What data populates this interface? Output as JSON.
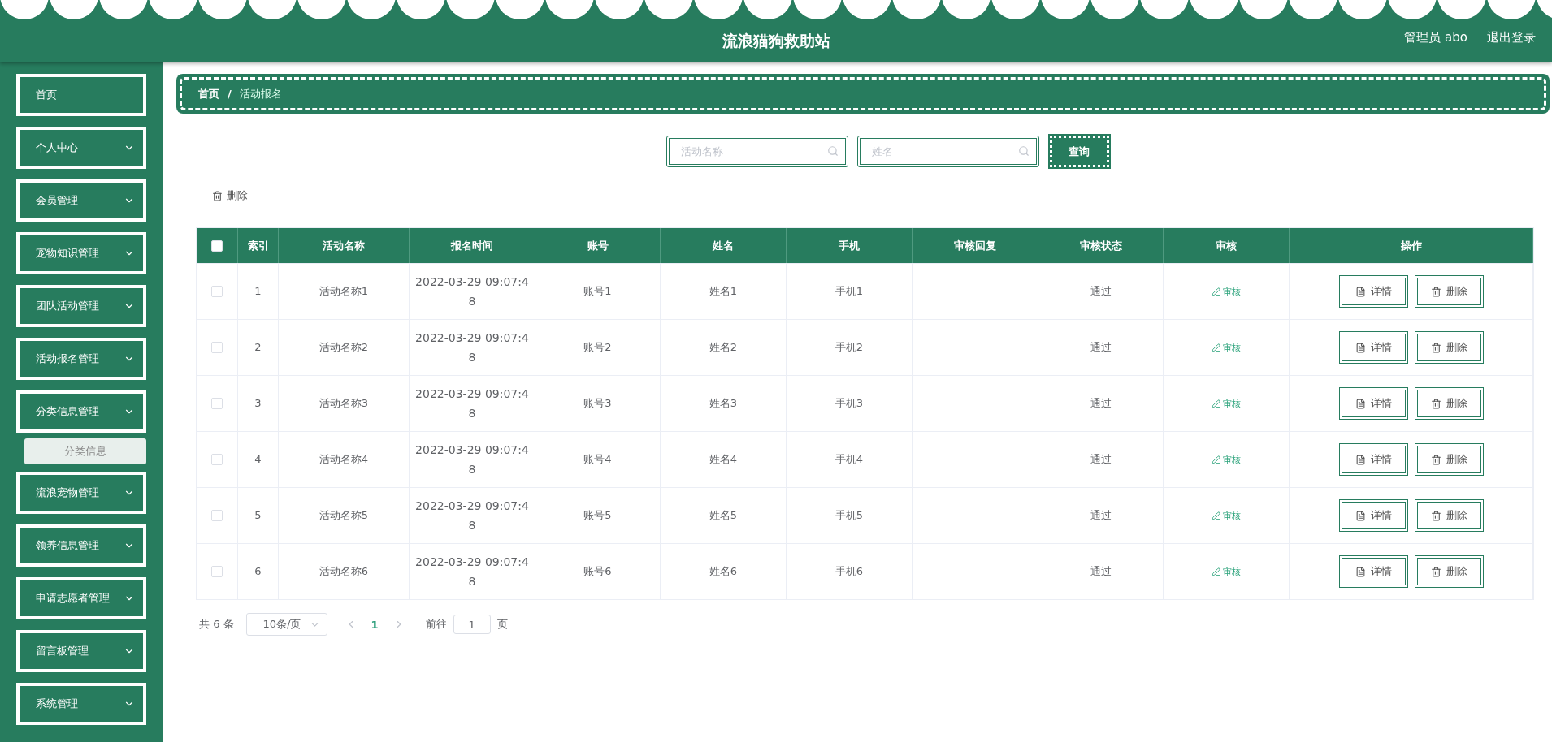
{
  "header": {
    "title": "流浪猫狗救助站",
    "user": "管理员 abo",
    "logout": "退出登录"
  },
  "sidebar": {
    "items": [
      {
        "label": "首页",
        "expandable": false
      },
      {
        "label": "个人中心",
        "expandable": true
      },
      {
        "label": "会员管理",
        "expandable": true
      },
      {
        "label": "宠物知识管理",
        "expandable": true
      },
      {
        "label": "团队活动管理",
        "expandable": true
      },
      {
        "label": "活动报名管理",
        "expandable": true
      },
      {
        "label": "分类信息管理",
        "expandable": true,
        "children": [
          {
            "label": "分类信息"
          }
        ]
      },
      {
        "label": "流浪宠物管理",
        "expandable": true
      },
      {
        "label": "领养信息管理",
        "expandable": true
      },
      {
        "label": "申请志愿者管理",
        "expandable": true
      },
      {
        "label": "留言板管理",
        "expandable": true
      },
      {
        "label": "系统管理",
        "expandable": true
      }
    ]
  },
  "breadcrumb": [
    "首页",
    "/",
    "活动报名"
  ],
  "search": {
    "fields": [
      {
        "placeholder": "活动名称"
      },
      {
        "placeholder": "姓名"
      }
    ],
    "button": "查询"
  },
  "toolbar": {
    "delete": "删除"
  },
  "table": {
    "header_checked": false,
    "columns": [
      "索引",
      "活动名称",
      "报名时间",
      "账号",
      "姓名",
      "手机",
      "审核回复",
      "审核状态",
      "审核",
      "操作"
    ],
    "rows": [
      {
        "selected": false,
        "cells": [
          "1",
          "活动名称1",
          "2022-03-29 09:07:48",
          "账号1",
          "姓名1",
          "手机1",
          "",
          "通过"
        ],
        "review": "审核",
        "actions": [
          "详情",
          "删除"
        ]
      },
      {
        "selected": false,
        "cells": [
          "2",
          "活动名称2",
          "2022-03-29 09:07:48",
          "账号2",
          "姓名2",
          "手机2",
          "",
          "通过"
        ],
        "review": "审核",
        "actions": [
          "详情",
          "删除"
        ]
      },
      {
        "selected": false,
        "cells": [
          "3",
          "活动名称3",
          "2022-03-29 09:07:48",
          "账号3",
          "姓名3",
          "手机3",
          "",
          "通过"
        ],
        "review": "审核",
        "actions": [
          "详情",
          "删除"
        ]
      },
      {
        "selected": false,
        "cells": [
          "4",
          "活动名称4",
          "2022-03-29 09:07:48",
          "账号4",
          "姓名4",
          "手机4",
          "",
          "通过"
        ],
        "review": "审核",
        "actions": [
          "详情",
          "删除"
        ]
      },
      {
        "selected": false,
        "cells": [
          "5",
          "活动名称5",
          "2022-03-29 09:07:48",
          "账号5",
          "姓名5",
          "手机5",
          "",
          "通过"
        ],
        "review": "审核",
        "actions": [
          "详情",
          "删除"
        ]
      },
      {
        "selected": false,
        "cells": [
          "6",
          "活动名称6",
          "2022-03-29 09:07:48",
          "账号6",
          "姓名6",
          "手机6",
          "",
          "通过"
        ],
        "review": "审核",
        "actions": [
          "详情",
          "删除"
        ]
      }
    ]
  },
  "pagination": {
    "total": "共 6 条",
    "page_size": "10条/页",
    "pages": [
      {
        "label": "1",
        "selected": true
      }
    ],
    "goto": "前往",
    "goto_value": "1",
    "goto_suffix": "页"
  }
}
